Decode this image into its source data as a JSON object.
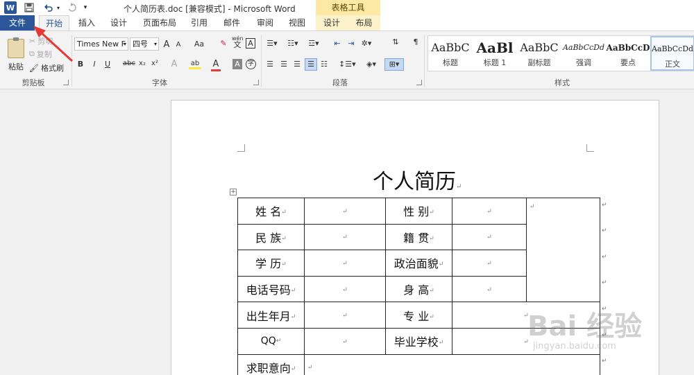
{
  "app": {
    "title": "个人简历表.doc [兼容模式] - Microsoft Word",
    "logo_letter": "W",
    "context_group": "表格工具"
  },
  "tabs": [
    "文件",
    "开始",
    "插入",
    "设计",
    "页面布局",
    "引用",
    "邮件",
    "审阅",
    "视图",
    "设计",
    "布局"
  ],
  "clipboard": {
    "paste": "粘贴",
    "cut": "剪切",
    "copy": "复制",
    "format_painter": "格式刷",
    "label": "剪贴板"
  },
  "font": {
    "name": "Times New F",
    "size": "四号",
    "label": "字体",
    "phonetic": "wén",
    "phonetic_char": "文",
    "box_char": "A",
    "grow": "A",
    "shrink": "A",
    "case": "Aa",
    "bold": "B",
    "italic": "I",
    "underline": "U",
    "strike": "abc",
    "sub": "x₂",
    "sup": "x²",
    "effects": "A",
    "highlight": "ab",
    "color": "A",
    "shade": "A",
    "enclose": "字"
  },
  "paragraph": {
    "label": "段落"
  },
  "styles": {
    "label": "样式",
    "items": [
      {
        "sample": "AaBbC",
        "name": "标题"
      },
      {
        "sample": "AaBl",
        "name": "标题 1"
      },
      {
        "sample": "AaBbC",
        "name": "副标题"
      },
      {
        "sample": "AaBbCcDd",
        "name": "强调"
      },
      {
        "sample": "AaBbCcD",
        "name": "要点"
      },
      {
        "sample": "AaBbCcDd",
        "name": "正文"
      }
    ]
  },
  "document": {
    "heading": "个人简历",
    "para_mark": "↵",
    "rows": [
      [
        "姓 名",
        "",
        "性 别",
        ""
      ],
      [
        "民 族",
        "",
        "籍 贯",
        ""
      ],
      [
        "学 历",
        "",
        "政治面貌",
        ""
      ],
      [
        "电话号码",
        "",
        "身 高",
        ""
      ],
      [
        "出生年月",
        "",
        "专 业",
        ""
      ],
      [
        "QQ",
        "",
        "毕业学校",
        ""
      ],
      [
        "求职意向",
        ""
      ]
    ]
  },
  "watermark": {
    "main": "Bai 经验",
    "sub": "jingyan.baidu.com"
  },
  "colors": {
    "accent": "#2b579a",
    "arrow": "#e53935",
    "context": "#fbe9a4"
  }
}
